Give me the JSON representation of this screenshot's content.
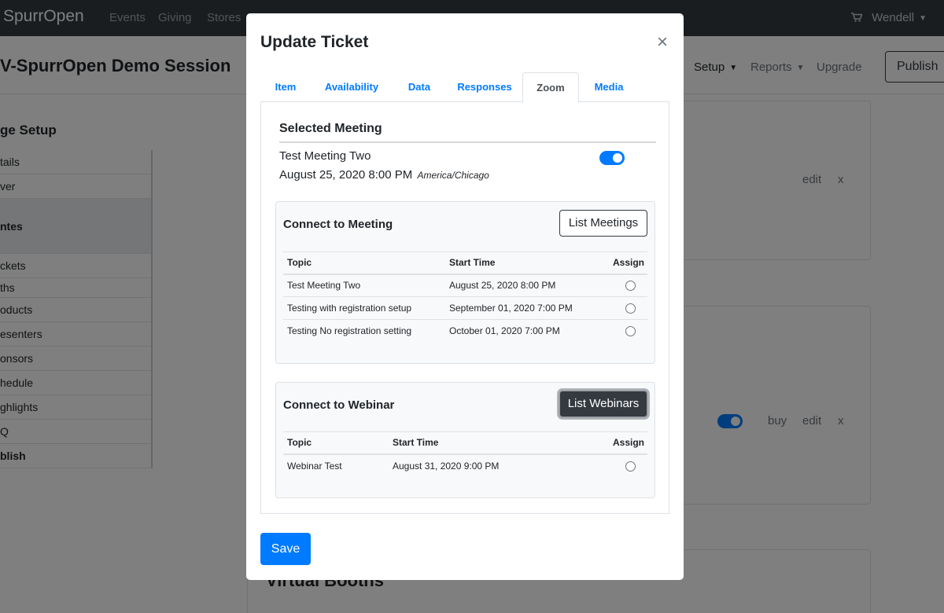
{
  "navbar": {
    "brand": "SpurrOpen",
    "links": [
      "Events",
      "Giving",
      "Stores"
    ],
    "user": "Wendell"
  },
  "subbar": {
    "title": "V-SpurrOpen Demo Session",
    "setup": "Setup",
    "reports": "Reports",
    "upgrade": "Upgrade",
    "publish": "Publish"
  },
  "sidebar": {
    "heading": "ge Setup",
    "items": [
      "tails",
      "ver",
      "ntes",
      "ckets",
      "ths",
      "oducts",
      "esenters",
      "onsors",
      "hedule",
      "ghlights",
      "Q",
      "blish"
    ]
  },
  "background": {
    "edit1": "edit",
    "x1": "x",
    "buy": "buy",
    "edit2": "edit",
    "x2": "x",
    "booths_title": "Virtual Booths"
  },
  "modal": {
    "title": "Update Ticket",
    "close": "×",
    "tabs": [
      "Item",
      "Availability",
      "Data",
      "Responses",
      "Zoom",
      "Media"
    ],
    "active_tab": "Zoom",
    "selected": {
      "heading": "Selected Meeting",
      "name": "Test Meeting Two",
      "datetime": "August 25, 2020 8:00 PM",
      "timezone": "America/Chicago",
      "enabled": true
    },
    "meeting": {
      "title": "Connect to Meeting",
      "button": "List Meetings",
      "headers": {
        "topic": "Topic",
        "start": "Start Time",
        "assign": "Assign"
      },
      "rows": [
        {
          "topic": "Test Meeting Two",
          "start": "August 25, 2020 8:00 PM"
        },
        {
          "topic": "Testing with registration setup",
          "start": "September 01, 2020 7:00 PM"
        },
        {
          "topic": "Testing No registration setting",
          "start": "October 01, 2020 7:00 PM"
        }
      ]
    },
    "webinar": {
      "title": "Connect to Webinar",
      "button": "List Webinars",
      "headers": {
        "topic": "Topic",
        "start": "Start Time",
        "assign": "Assign"
      },
      "rows": [
        {
          "topic": "Webinar Test",
          "start": "August 31, 2020 9:00 PM"
        }
      ]
    },
    "save": "Save"
  },
  "colors": {
    "primary": "#007bff",
    "dark": "#343a40",
    "navbar": "#343a40"
  }
}
